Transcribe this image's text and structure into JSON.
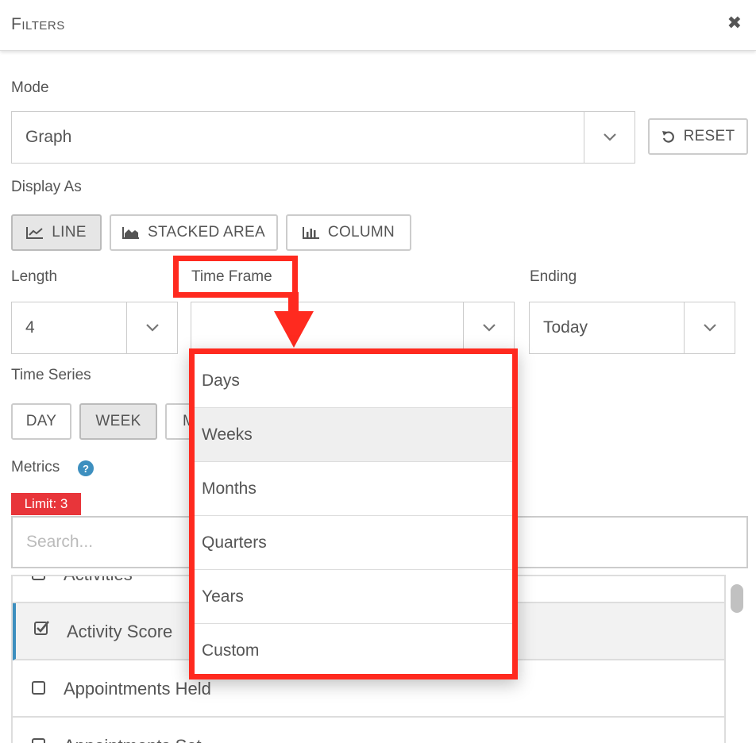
{
  "header": {
    "title": "Filters"
  },
  "mode": {
    "label": "Mode",
    "value": "Graph",
    "reset_label": "RESET"
  },
  "display_as": {
    "label": "Display As",
    "options": [
      {
        "label": "LINE",
        "active": true
      },
      {
        "label": "STACKED AREA",
        "active": false
      },
      {
        "label": "COLUMN",
        "active": false
      }
    ]
  },
  "length": {
    "label": "Length",
    "value": "4"
  },
  "time_frame": {
    "label": "Time Frame",
    "value": "",
    "options": [
      "Days",
      "Weeks",
      "Months",
      "Quarters",
      "Years",
      "Custom"
    ],
    "hovered": "Weeks"
  },
  "ending": {
    "label": "Ending",
    "value": "Today"
  },
  "time_series": {
    "label": "Time Series",
    "options": [
      {
        "label": "DAY",
        "active": false
      },
      {
        "label": "WEEK",
        "active": true
      },
      {
        "label": "M",
        "active": false
      }
    ]
  },
  "metrics": {
    "label": "Metrics",
    "help_icon": "?",
    "limit": "Limit: 3",
    "search_placeholder": "Search...",
    "items": [
      {
        "label": "Activities",
        "checked": false
      },
      {
        "label": "Activity Score",
        "checked": true
      },
      {
        "label": "Appointments Held",
        "checked": false
      },
      {
        "label": "Appointments Set",
        "checked": false
      }
    ]
  },
  "colors": {
    "accent": "#3d8fbf",
    "highlight": "#ff2a1f",
    "limit_badge": "#e8353a"
  }
}
